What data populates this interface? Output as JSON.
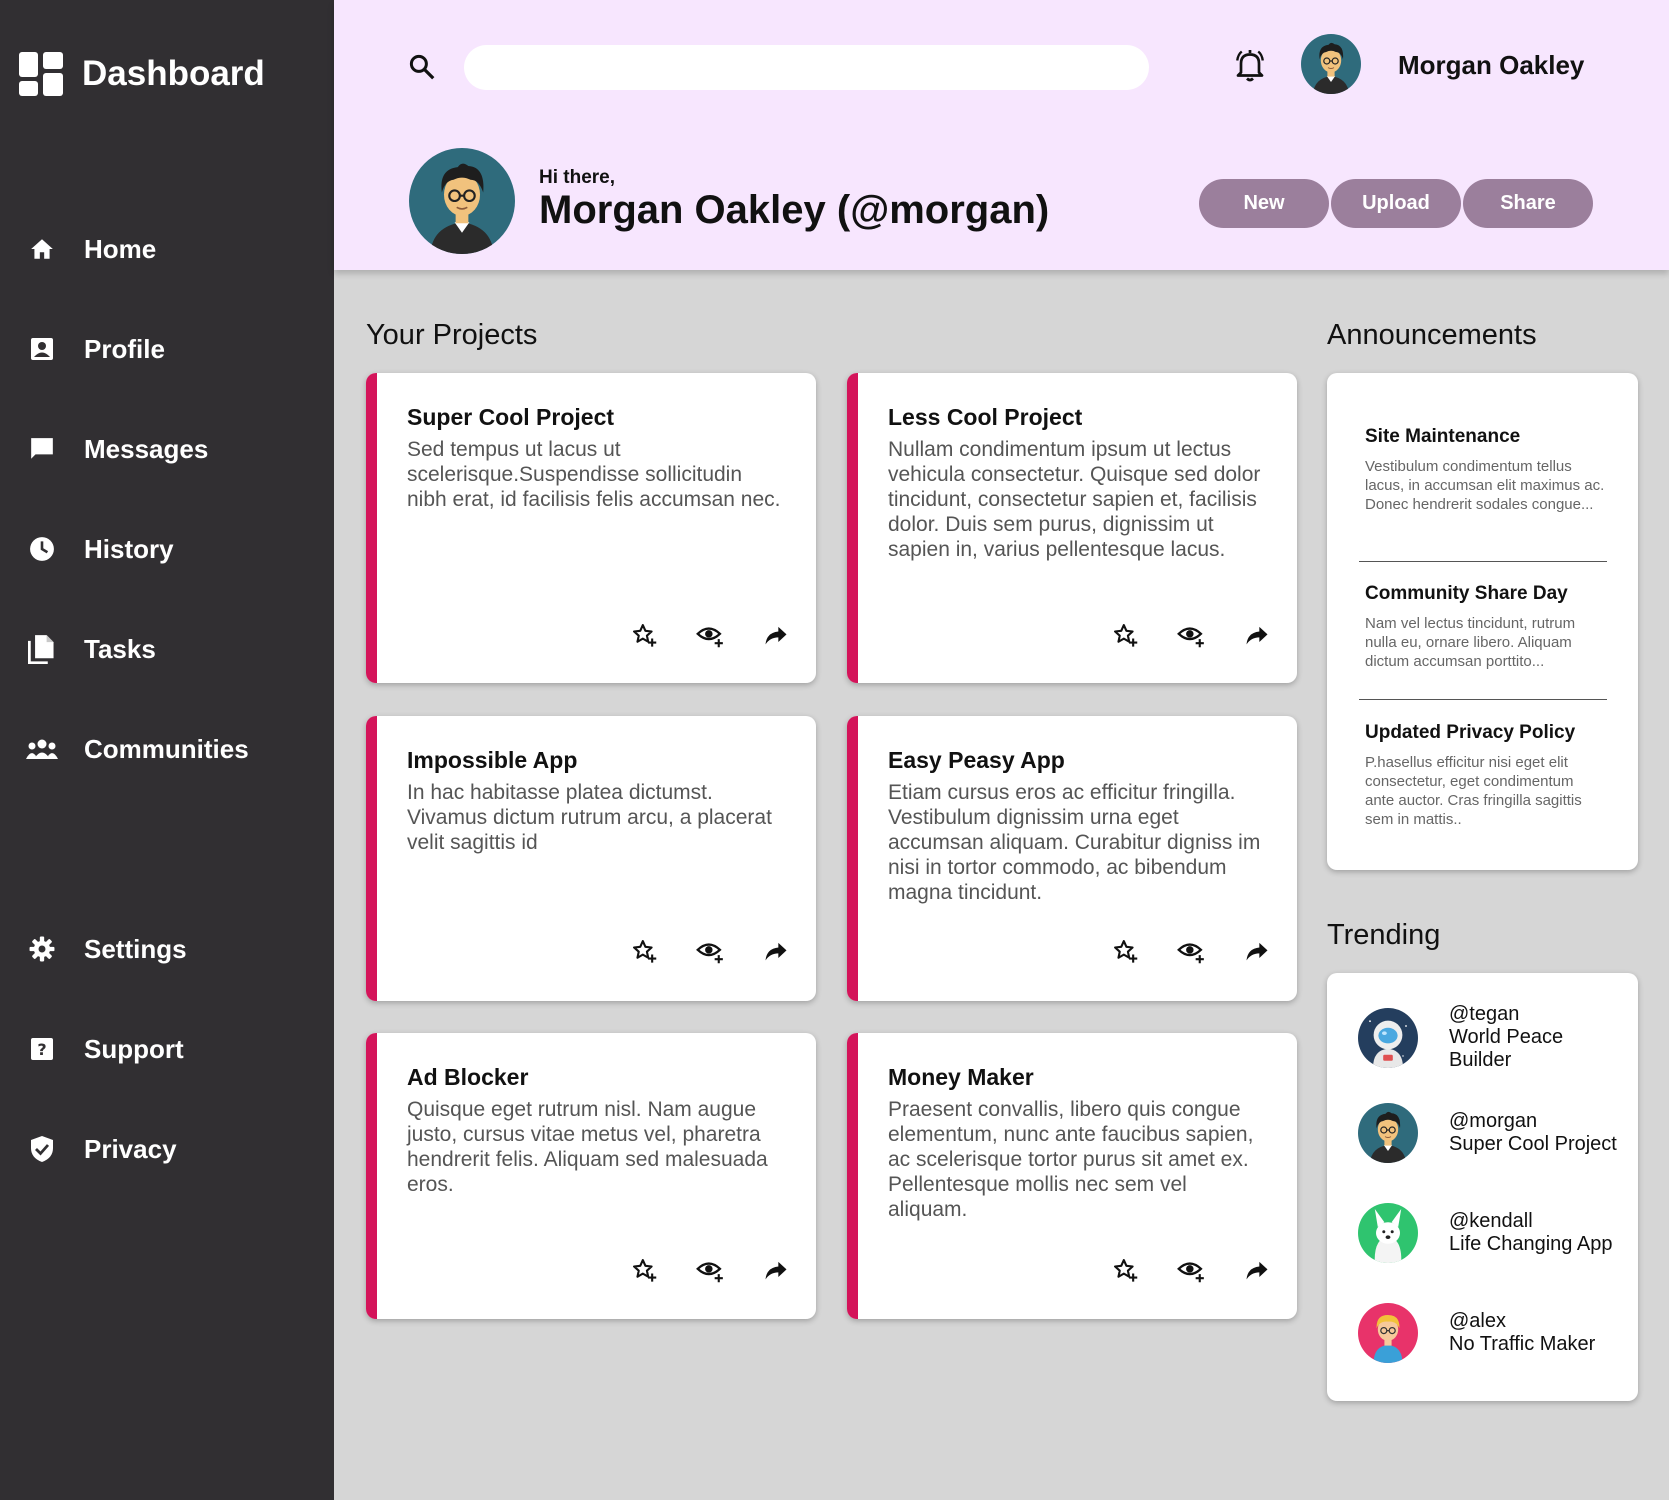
{
  "brand": {
    "label": "Dashboard",
    "icon": "dashboard-grid-icon"
  },
  "nav": {
    "home": "Home",
    "profile": "Profile",
    "messages": "Messages",
    "history": "History",
    "tasks": "Tasks",
    "communities": "Communities",
    "settings": "Settings",
    "support": "Support",
    "privacy": "Privacy"
  },
  "header": {
    "search_placeholder": "",
    "username": "Morgan Oakley",
    "greeting": "Hi there,",
    "full_name": "Morgan Oakley (@morgan)",
    "buttons": {
      "new": "New",
      "upload": "Upload",
      "share": "Share"
    }
  },
  "projects": {
    "title": "Your Projects",
    "items": [
      {
        "title": "Super Cool Project",
        "desc": "Sed tempus ut lacus ut scelerisque.Suspendisse sollicitudin nibh erat, id facilisis felis accumsan nec."
      },
      {
        "title": "Less Cool Project",
        "desc": "Nullam condimentum ipsum ut lectus vehicula consectetur. Quisque sed dolor tincidunt, consectetur sapien et, facilisis dolor. Duis sem purus, dignissim ut sapien in, varius pellentesque lacus."
      },
      {
        "title": "Impossible App",
        "desc": "In hac habitasse platea dictumst. Vivamus dictum rutrum arcu, a placerat velit sagittis id"
      },
      {
        "title": "Easy Peasy App",
        "desc": "Etiam cursus eros ac efficitur fringilla. Vestibulum dignissim urna eget accumsan aliquam. Curabitur digniss im nisi in tortor commodo, ac bibendum magna tincidunt."
      },
      {
        "title": "Ad Blocker",
        "desc": "Quisque eget rutrum nisl. Nam augue justo, cursus vitae metus vel, pharetra hendrerit felis. Aliquam sed malesuada eros."
      },
      {
        "title": "Money Maker",
        "desc": "Praesent convallis, libero quis congue elementum, nunc ante faucibus sapien, ac scelerisque tortor purus sit amet ex. Pellentesque mollis nec sem vel aliquam."
      }
    ]
  },
  "announcements": {
    "title": "Announcements",
    "items": [
      {
        "title": "Site Maintenance",
        "text": "Vestibulum condimentum tellus lacus, in accumsan elit maximus ac. Donec hendrerit sodales congue..."
      },
      {
        "title": "Community Share Day",
        "text": "Nam vel lectus tincidunt, rutrum nulla eu, ornare libero. Aliquam dictum accumsan porttito..."
      },
      {
        "title": "Updated Privacy Policy",
        "text": "P.hasellus efficitur nisi eget elit consectetur, eget condimentum ante auctor. Cras fringilla sagittis sem in mattis.."
      }
    ]
  },
  "trending": {
    "title": "Trending",
    "items": [
      {
        "handle": "@tegan",
        "project": "World Peace Builder"
      },
      {
        "handle": "@morgan",
        "project": "Super Cool Project"
      },
      {
        "handle": "@kendall",
        "project": "Life Changing App"
      },
      {
        "handle": "@alex",
        "project": "No Traffic Maker"
      }
    ]
  },
  "colors": {
    "sidebar": "#312f32",
    "header": "#f7e6fe",
    "accent": "#d4145a",
    "button": "#9b7f9c",
    "background": "#d6d6d6"
  }
}
